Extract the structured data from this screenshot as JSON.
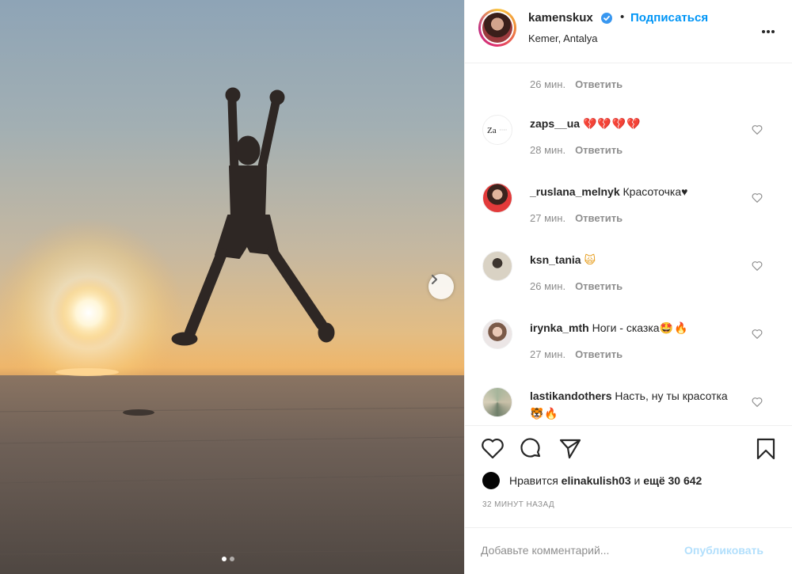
{
  "post": {
    "username": "kamenskux",
    "follow_label": "Подписаться",
    "separator": "•",
    "location": "Kemer, Antalya"
  },
  "comments": {
    "first_meta": {
      "time": "26 мин.",
      "reply": "Ответить"
    },
    "items": [
      {
        "user": "zaps__ua",
        "text": "",
        "emoji": "💔💔💔💔",
        "time": "28 мин.",
        "reply": "Ответить"
      },
      {
        "user": "_ruslana_melnyk",
        "text": "Красоточка",
        "emoji": "♥",
        "time": "27 мин.",
        "reply": "Ответить"
      },
      {
        "user": "ksn_tania",
        "text": "",
        "emoji": "🙀",
        "time": "26 мин.",
        "reply": "Ответить"
      },
      {
        "user": "irynka_mth",
        "text": "Ноги - сказка",
        "emoji": "🤩🔥",
        "time": "27 мин.",
        "reply": "Ответить"
      },
      {
        "user": "lastikandothers",
        "text": "Насть, ну ты красотка",
        "emoji": "🐯🔥"
      }
    ]
  },
  "likes": {
    "prefix": "Нравится",
    "user": "elinakulish03",
    "middle": "и",
    "rest": "ещё 30 642"
  },
  "time_ago": "32 МИНУТ НАЗАД",
  "comment_box": {
    "placeholder": "Добавьте комментарий...",
    "post_label": "Опубликовать"
  },
  "carousel": {
    "current": 1,
    "total": 2
  },
  "colors": {
    "link": "#0095f6",
    "muted": "#8e8e8e",
    "post_disabled": "#b2dffc",
    "verified": "#3897f0"
  },
  "icons": [
    "verified-badge-icon",
    "more-options-icon",
    "heart-icon",
    "comment-icon",
    "share-icon",
    "bookmark-icon",
    "next-arrow-icon"
  ]
}
